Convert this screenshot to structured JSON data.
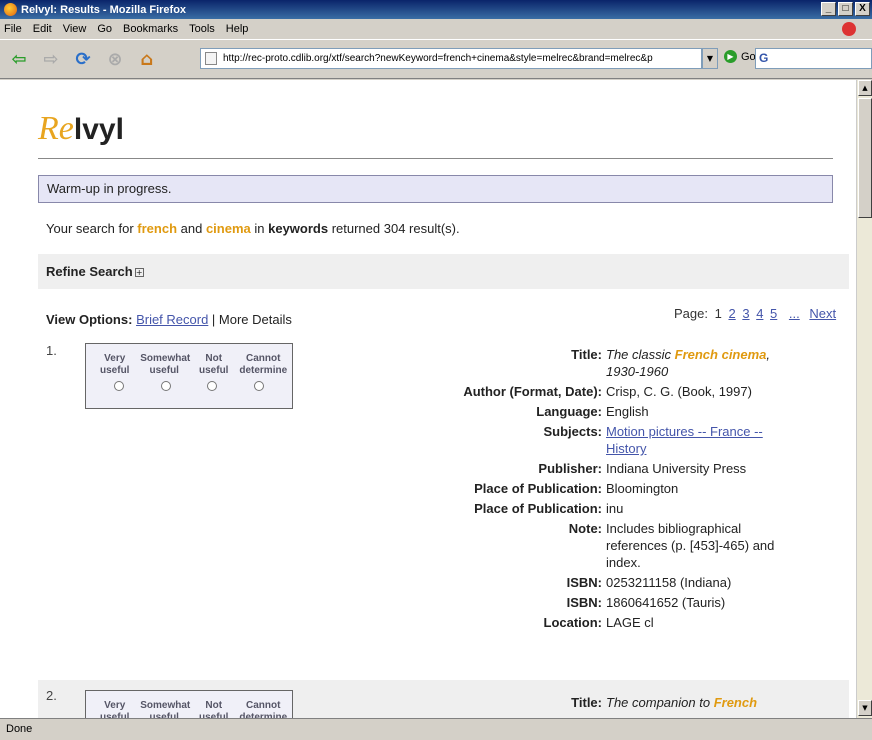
{
  "window": {
    "title": "Relvyl: Results - Mozilla Firefox",
    "min": "_",
    "max": "□",
    "close": "X"
  },
  "menu": [
    "File",
    "Edit",
    "View",
    "Go",
    "Bookmarks",
    "Tools",
    "Help"
  ],
  "toolbar": {
    "url": "http://rec-proto.cdlib.org/xtf/search?newKeyword=french+cinema&style=melrec&brand=melrec&p",
    "go": "Go",
    "gsearch": "G"
  },
  "logo": {
    "re": "Re",
    "vyl": "lvyl"
  },
  "banner": "Warm-up in progress.",
  "search": {
    "prefix": "Your search for ",
    "term1": "french",
    "and": " and ",
    "term2": "cinema",
    "in": " in ",
    "field": "keywords",
    "suffix": " returned 304 result(s)."
  },
  "refine": "Refine Search",
  "refine_plus": "+",
  "view": {
    "label": "View Options:",
    "brief": "Brief Record",
    "sep": " | ",
    "more": "More Details"
  },
  "pager": {
    "label": "Page:",
    "current": "1",
    "pages": [
      "2",
      "3",
      "4",
      "5"
    ],
    "ellipsis": "...",
    "next": "Next"
  },
  "rating": {
    "cols": [
      "Very useful",
      "Somewhat useful",
      "Not useful",
      "Cannot determine"
    ]
  },
  "records": [
    {
      "num": "1.",
      "fields": [
        {
          "label": "Title:",
          "value_pre": "The classic ",
          "value_hl": "French cinema",
          "value_post": ", 1930-1960"
        },
        {
          "label": "Author (Format, Date):",
          "value": "Crisp, C. G. (Book, 1997)"
        },
        {
          "label": "Language:",
          "value": "English"
        },
        {
          "label": "Subjects:",
          "value": "Motion pictures -- France -- History"
        },
        {
          "label": "Publisher:",
          "value": "Indiana University Press"
        },
        {
          "label": "Place of Publication:",
          "value": "Bloomington"
        },
        {
          "label": "Place of Publication:",
          "value": "inu"
        },
        {
          "label": "Note:",
          "value": "Includes bibliographical references (p. [453]-465) and index."
        },
        {
          "label": "ISBN:",
          "value": "0253211158 (Indiana)"
        },
        {
          "label": "ISBN:",
          "value": "1860641652 (Tauris)"
        },
        {
          "label": "Location:",
          "value": "LAGE cl"
        }
      ]
    },
    {
      "num": "2.",
      "fields": [
        {
          "label": "Title:",
          "value_pre": "The companion to ",
          "value_hl": "French",
          "value_post": ""
        }
      ]
    }
  ],
  "status": "Done"
}
